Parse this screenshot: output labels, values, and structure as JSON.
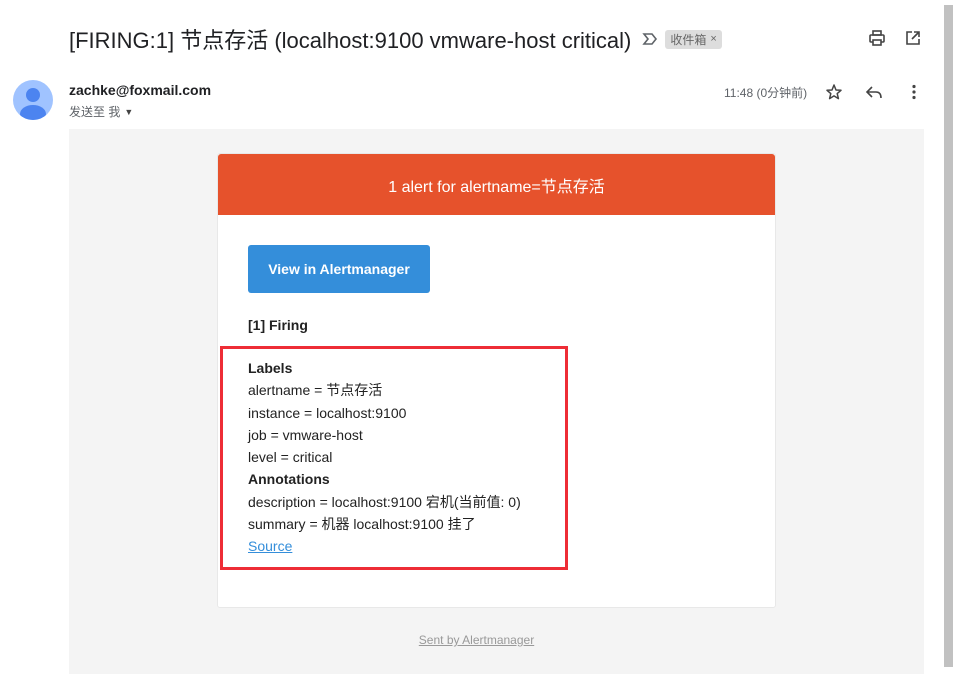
{
  "email": {
    "subject": "[FIRING:1] 节点存活 (localhost:9100 vmware-host critical)",
    "label_chip": "收件箱",
    "label_chip_close": "×",
    "sender": "zachke@foxmail.com",
    "to_me": "发送至 我",
    "time": "11:48 (0分钟前)"
  },
  "icons": {
    "label_importance": "importance-marker-icon",
    "print": "print-icon",
    "open_new_window": "open-in-new-icon",
    "star": "star-icon",
    "reply": "reply-icon",
    "more": "more-vertical-icon"
  },
  "alert": {
    "header": "1 alert for alertname=节点存活",
    "view_button": "View in Alertmanager",
    "firing_label": "[1] Firing",
    "labels_heading": "Labels",
    "labels": [
      "alertname = 节点存活",
      "instance = localhost:9100",
      "job = vmware-host",
      "level = critical"
    ],
    "annotations_heading": "Annotations",
    "annotations": [
      "description = localhost:9100 宕机(当前值: 0)",
      "summary = 机器 localhost:9100 挂了"
    ],
    "source_link": "Source",
    "footer": "Sent by Alertmanager"
  },
  "colors": {
    "header_bg": "#e6522c",
    "button_bg": "#348eda",
    "highlight_border": "#ee2d36",
    "mail_bg": "#f4f4f4"
  }
}
